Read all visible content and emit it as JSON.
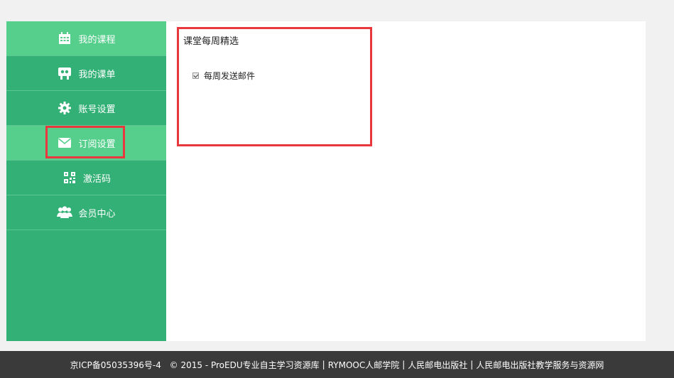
{
  "sidebar": {
    "items": [
      {
        "label": "我的课程",
        "icon": "calendar-icon"
      },
      {
        "label": "我的课单",
        "icon": "presentation-icon"
      },
      {
        "label": "账号设置",
        "icon": "gear-icon"
      },
      {
        "label": "订阅设置",
        "icon": "envelope-icon",
        "active": true
      },
      {
        "label": "激活码",
        "icon": "qrcode-icon"
      },
      {
        "label": "会员中心",
        "icon": "users-icon"
      }
    ]
  },
  "main": {
    "section_title": "课堂每周精选",
    "weekly_email": {
      "label": "每周发送邮件",
      "checked": true
    }
  },
  "footer": {
    "icp": "京ICP备05035396号-4",
    "copyright": "© 2015 - ProEDU专业自主学习资源库",
    "link1": "RYMOOC人邮学院",
    "link2": "人民邮电出版社",
    "link3": "人民邮电出版社教学服务与资源网"
  },
  "colors": {
    "sidebar_bg": "#33b075",
    "sidebar_active": "#56cf8c",
    "highlight": "#e8383d",
    "footer_bg": "#3a3a3a"
  }
}
